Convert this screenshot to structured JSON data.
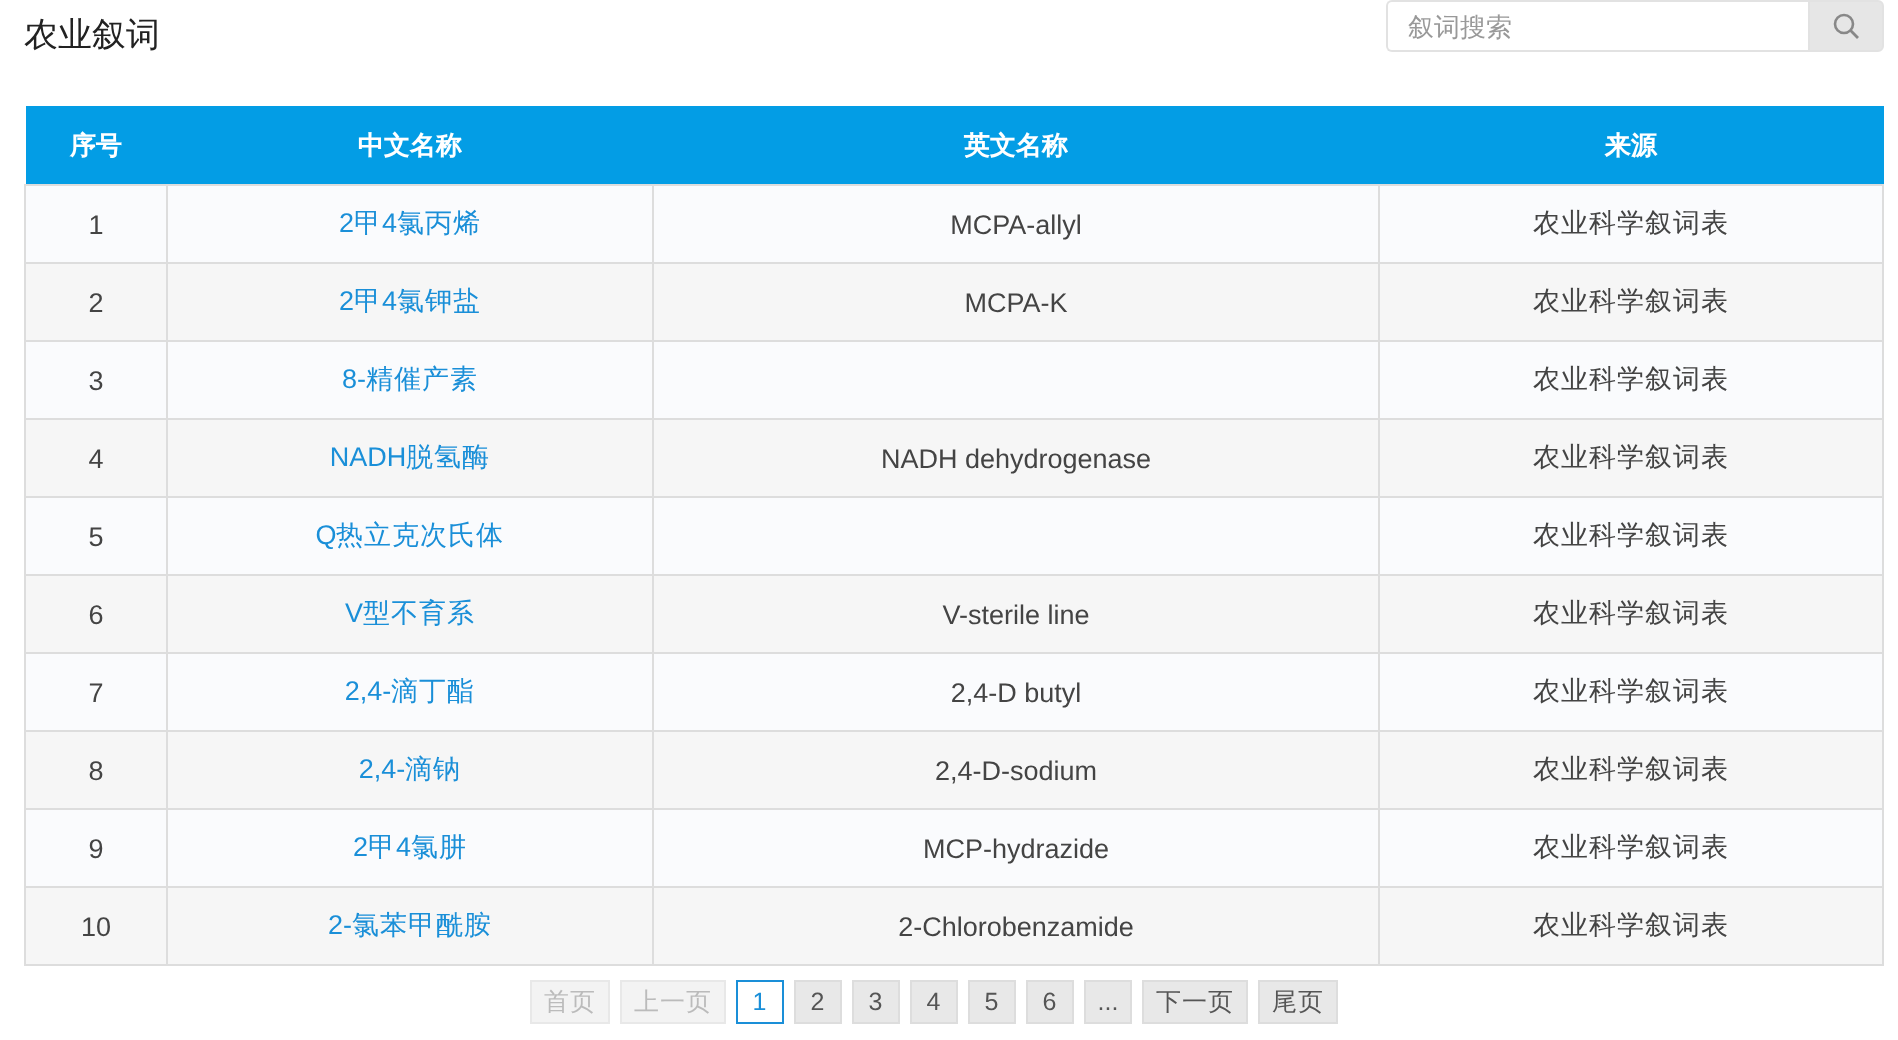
{
  "page": {
    "title": "农业叙词"
  },
  "search": {
    "placeholder": "叙词搜索"
  },
  "table": {
    "columns": [
      "序号",
      "中文名称",
      "英文名称",
      "来源"
    ],
    "rows": [
      {
        "index": "1",
        "chinese": "2甲4氯丙烯",
        "english": "MCPA-allyl",
        "source": "农业科学叙词表"
      },
      {
        "index": "2",
        "chinese": "2甲4氯钾盐",
        "english": "MCPA-K",
        "source": "农业科学叙词表"
      },
      {
        "index": "3",
        "chinese": "8-精催产素",
        "source": "农业科学叙词表"
      },
      {
        "index": "4",
        "chinese": "NADH脱氢酶",
        "english": "NADH dehydrogenase",
        "source": "农业科学叙词表"
      },
      {
        "index": "5",
        "chinese": "Q热立克次氏体",
        "source": "农业科学叙词表"
      },
      {
        "index": "6",
        "chinese": "V型不育系",
        "english": "V-sterile line",
        "source": "农业科学叙词表"
      },
      {
        "index": "7",
        "chinese": "2,4-滴丁酯",
        "english": "2,4-D butyl",
        "source": "农业科学叙词表"
      },
      {
        "index": "8",
        "chinese": "2,4-滴钠",
        "english": "2,4-D-sodium",
        "source": "农业科学叙词表"
      },
      {
        "index": "9",
        "chinese": "2甲4氯肼",
        "english": "MCP-hydrazide",
        "source": "农业科学叙词表"
      },
      {
        "index": "10",
        "chinese": "2-氯苯甲酰胺",
        "english": "2-Chlorobenzamide",
        "source": "农业科学叙词表"
      }
    ]
  },
  "pagination": [
    {
      "label": "首页",
      "disabled": true,
      "selected": false
    },
    {
      "label": "上一页",
      "disabled": true,
      "selected": false
    },
    {
      "label": "1",
      "disabled": false,
      "selected": true
    },
    {
      "label": "2",
      "disabled": false,
      "selected": false
    },
    {
      "label": "3",
      "disabled": false,
      "selected": false
    },
    {
      "label": "4",
      "disabled": false,
      "selected": false
    },
    {
      "label": "5",
      "disabled": false,
      "selected": false
    },
    {
      "label": "6",
      "disabled": false,
      "selected": false
    },
    {
      "label": "...",
      "disabled": false,
      "selected": false
    },
    {
      "label": "下一页",
      "disabled": false,
      "selected": false
    },
    {
      "label": "尾页",
      "disabled": false,
      "selected": false
    }
  ]
}
